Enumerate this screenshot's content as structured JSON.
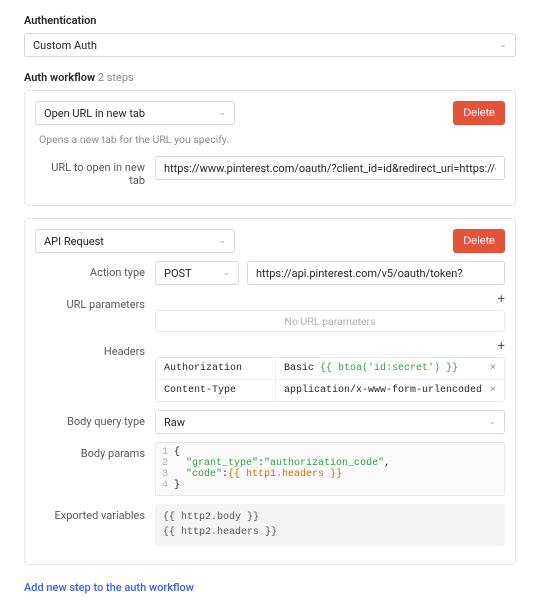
{
  "section": {
    "title": "Authentication"
  },
  "auth_type": {
    "selected": "Custom Auth"
  },
  "workflow": {
    "title": "Auth workflow",
    "steps_label": "2 steps"
  },
  "step1": {
    "type": "Open URL in new tab",
    "delete": "Delete",
    "hint": "Opens a new tab for the URL you specify.",
    "url_label": "URL to open in new tab",
    "url_value": "https://www.pinterest.com/oauth/?client_id=id&redirect_uri=https://oauth.retool.co"
  },
  "step2": {
    "type": "API Request",
    "delete": "Delete",
    "action_type_label": "Action type",
    "action_type_value": "POST",
    "url_value": "https://api.pinterest.com/v5/oauth/token?",
    "url_params_label": "URL parameters",
    "url_params_empty": "No URL parameters",
    "headers_label": "Headers",
    "headers": [
      {
        "key": "Authorization",
        "prefix": "Basic ",
        "tmpl": "{{ btoa('id:secret') }}"
      },
      {
        "key": "Content-Type",
        "value": "application/x-www-form-urlencoded"
      }
    ],
    "body_type_label": "Body query type",
    "body_type_value": "Raw",
    "body_params_label": "Body params",
    "code": {
      "l1n": "1",
      "l1": "{",
      "l2n": "2",
      "l2a": "  ",
      "l2b": "\"grant_type\"",
      "l2c": ":",
      "l2d": "\"authorization_code\"",
      "l2e": ",",
      "l3n": "3",
      "l3a": "  ",
      "l3b": "\"code\"",
      "l3c": ":",
      "l3d": "{{ http1.headers }}",
      "l4n": "4",
      "l4": "}"
    },
    "exported_label": "Exported variables",
    "exported_l1": "{{ http2.body }}",
    "exported_l2": "{{ http2.headers }}"
  },
  "add_step": "Add new step to the auth workflow"
}
